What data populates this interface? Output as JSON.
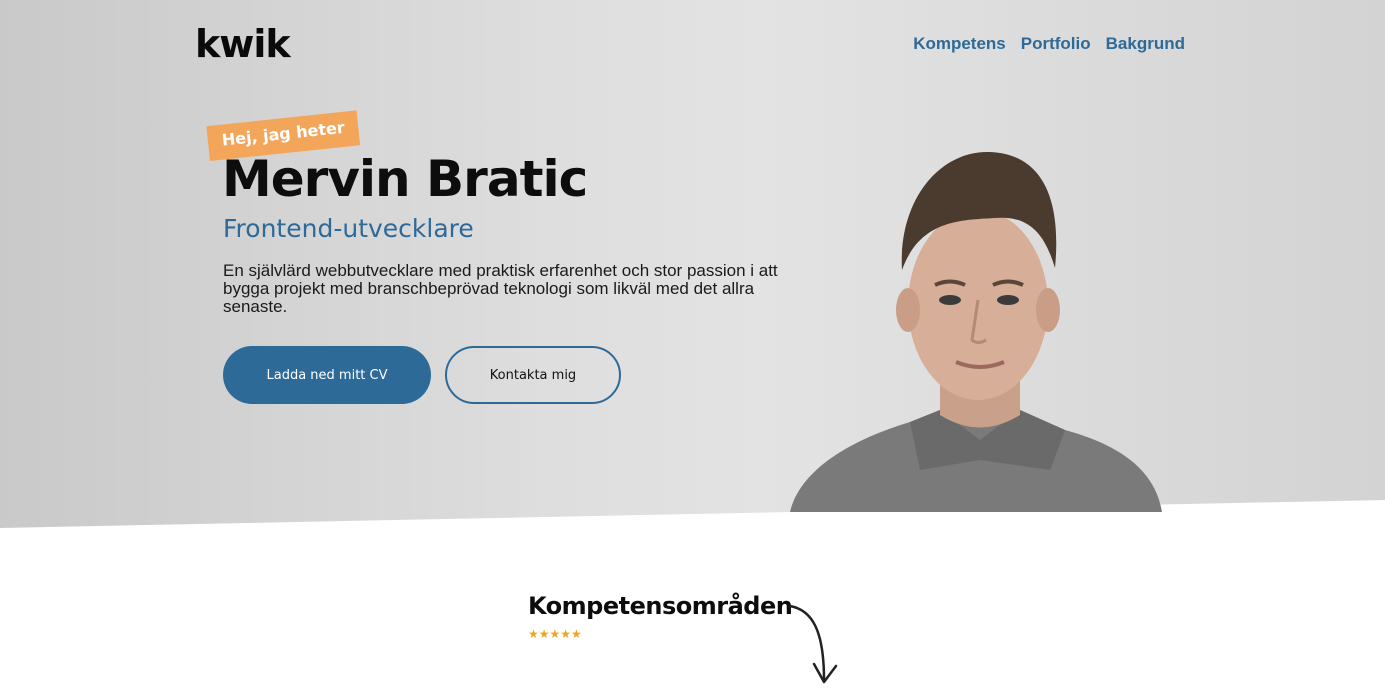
{
  "header": {
    "logo": "kwik",
    "nav": [
      {
        "label": "Kompetens"
      },
      {
        "label": "Portfolio"
      },
      {
        "label": "Bakgrund"
      }
    ]
  },
  "hero": {
    "tag": "Hej, jag heter",
    "name": "Mervin Bratic",
    "role": "Frontend-utvecklare",
    "description": "En självlärd webbutvecklare med praktisk erfarenhet och stor passion i att bygga projekt med branschbeprövad teknologi som likväl med det allra senaste.",
    "cv_button": "Ladda ned mitt CV",
    "contact_button": "Kontakta mig"
  },
  "skills": {
    "title": "Kompetensområden",
    "stars": "★★★★★"
  },
  "colors": {
    "accent": "#2d6a98",
    "tag": "#f3a65a",
    "stars": "#f0a61b"
  }
}
